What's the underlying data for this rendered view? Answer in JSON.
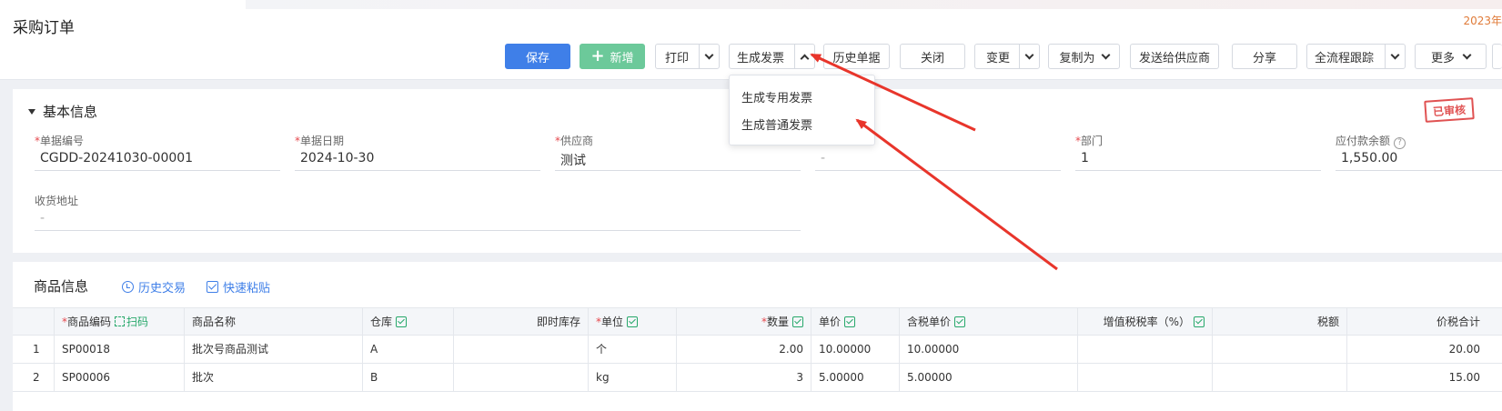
{
  "header": {
    "title": "采购订单",
    "year_tag": "2023年"
  },
  "toolbar": {
    "save": "保存",
    "add": "新增",
    "print": "打印",
    "generate_invoice": "生成发票",
    "history": "历史单据",
    "close": "关闭",
    "change": "变更",
    "copy_as": "复制为",
    "send_supplier": "发送给供应商",
    "share": "分享",
    "full_trace": "全流程跟踪",
    "more": "更多"
  },
  "invoice_menu": {
    "items": [
      "生成专用发票",
      "生成普通发票"
    ]
  },
  "basic": {
    "title": "基本信息",
    "stamp": "已审核",
    "fields": [
      {
        "label": "单据编号",
        "required": true,
        "value": "CGDD-20241030-00001"
      },
      {
        "label": "单据日期",
        "required": true,
        "value": "2024-10-30"
      },
      {
        "label": "供应商",
        "required": true,
        "value": "测试"
      },
      {
        "label": "",
        "required": false,
        "value": "-"
      },
      {
        "label": "部门",
        "required": true,
        "value": "1"
      },
      {
        "label": "应付款余额",
        "required": false,
        "value": "1,550.00"
      },
      {
        "label": "收货地址",
        "required": false,
        "value": "-"
      }
    ]
  },
  "goods": {
    "title": "商品信息",
    "history_link": "历史交易",
    "paste_link": "快速粘贴",
    "scan": "扫码",
    "columns": [
      "",
      "商品编码",
      "商品名称",
      "仓库",
      "即时库存",
      "单位",
      "数量",
      "单价",
      "含税单价",
      "增值税税率（%）",
      "税额",
      "价税合计"
    ],
    "rows": [
      [
        "1",
        "SP00018",
        "批次号商品测试",
        "A",
        "",
        "个",
        "2.00",
        "10.00000",
        "10.00000",
        "",
        "",
        "20.00"
      ],
      [
        "2",
        "SP00006",
        "批次",
        "B",
        "",
        "kg",
        "3",
        "5.00000",
        "5.00000",
        "",
        "",
        "15.00"
      ]
    ]
  },
  "colors": {
    "primary": "#3f7fe8",
    "success": "#6cc99a",
    "arrow": "#e8352b",
    "stamp": "#e05252"
  }
}
